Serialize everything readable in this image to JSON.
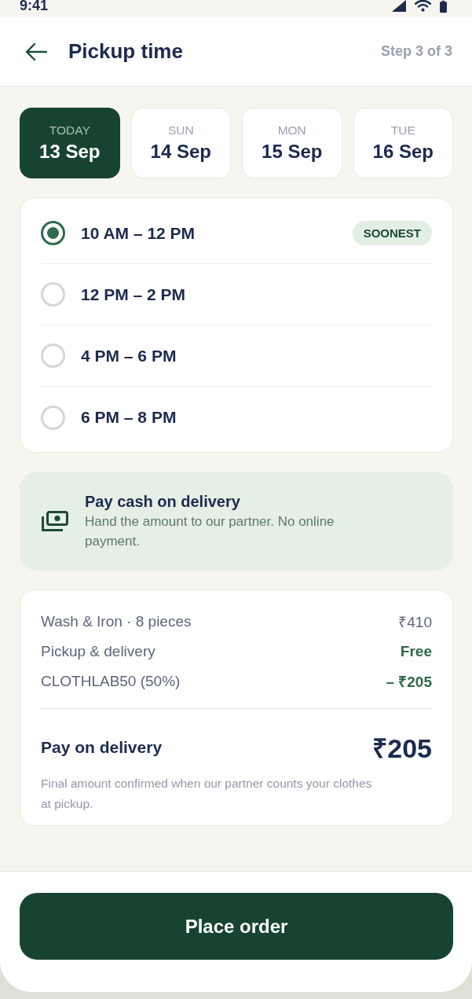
{
  "status_bar": {
    "time": "9:41"
  },
  "header": {
    "title": "Pickup time",
    "step": "Step 3 of 3"
  },
  "dates": [
    {
      "day": "TODAY",
      "date": "13 Sep",
      "selected": true
    },
    {
      "day": "SUN",
      "date": "14 Sep",
      "selected": false
    },
    {
      "day": "MON",
      "date": "15 Sep",
      "selected": false
    },
    {
      "day": "TUE",
      "date": "16 Sep",
      "selected": false
    }
  ],
  "time_slots": [
    {
      "label": "10 AM – 12 PM",
      "selected": true,
      "badge": "SOONEST"
    },
    {
      "label": "12 PM – 2 PM",
      "selected": false
    },
    {
      "label": "4 PM – 6 PM",
      "selected": false
    },
    {
      "label": "6 PM – 8 PM",
      "selected": false
    }
  ],
  "payment_notice": {
    "title": "Pay cash on delivery",
    "description": "Hand the amount to our partner. No online payment."
  },
  "summary": {
    "lines": [
      {
        "label": "Wash & Iron · 8 pieces",
        "value": "₹410",
        "kind": "charge"
      },
      {
        "label": "Pickup & delivery",
        "value": "Free",
        "kind": "saving"
      },
      {
        "label": "CLOTHLAB50 (50%)",
        "value": "– ₹205",
        "kind": "saving"
      }
    ],
    "total_label": "Pay on delivery",
    "total": "₹205",
    "note": "Final amount confirmed when our partner counts your clothes at pickup."
  },
  "primary_button": "Place order"
}
